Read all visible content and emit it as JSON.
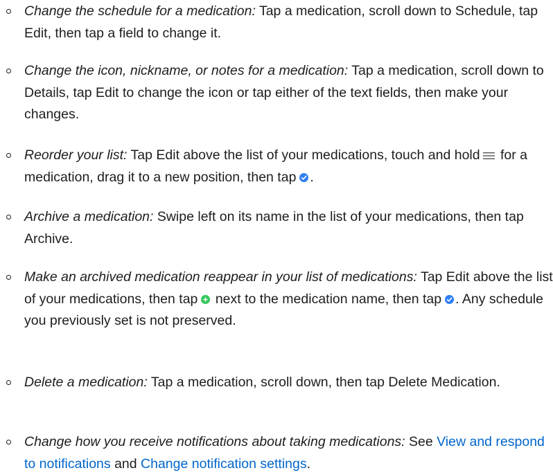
{
  "colors": {
    "text": "#1d1d1f",
    "link": "#0066cc",
    "done_blue": "#2f7ff5",
    "add_green": "#34c759"
  },
  "items": [
    {
      "title": "Change the schedule for a medication:",
      "text": " Tap a medication, scroll down to Schedule, tap Edit, then tap a field to change it."
    },
    {
      "title": "Change the icon, nickname, or notes for a medication:",
      "text": " Tap a medication, scroll down to Details, tap Edit to change the icon or tap either of the text fields, then make your changes."
    },
    {
      "title": "Reorder your list:",
      "text_before_icon": " Tap Edit above the list of your medications, touch and hold",
      "icon_name": "reorder-icon",
      "text_after_icon": " for a medication, drag it to a new position, then tap",
      "icon2_name": "checkmark-circle-icon",
      "text_end": "."
    },
    {
      "title": "Archive a medication:",
      "text": " Swipe left on its name in the list of your medications, then tap Archive."
    },
    {
      "title": "Make an archived medication reappear in your list of medications:",
      "text_before_icon": " Tap Edit above the list of your medications, then tap",
      "icon_name": "add-circle-icon",
      "text_after_icon": " next to the medication name, then tap",
      "icon2_name": "checkmark-circle-icon",
      "text_end": ". Any schedule you previously set is not preserved."
    },
    {
      "title": "Delete a medication:",
      "text": " Tap a medication, scroll down, then tap Delete Medication."
    },
    {
      "title": "Change how you receive notifications about taking medications:",
      "text_before": " See ",
      "link1": "View and respond to notifications",
      "text_middle": " and ",
      "link2": "Change notification settings",
      "text_end": "."
    }
  ]
}
